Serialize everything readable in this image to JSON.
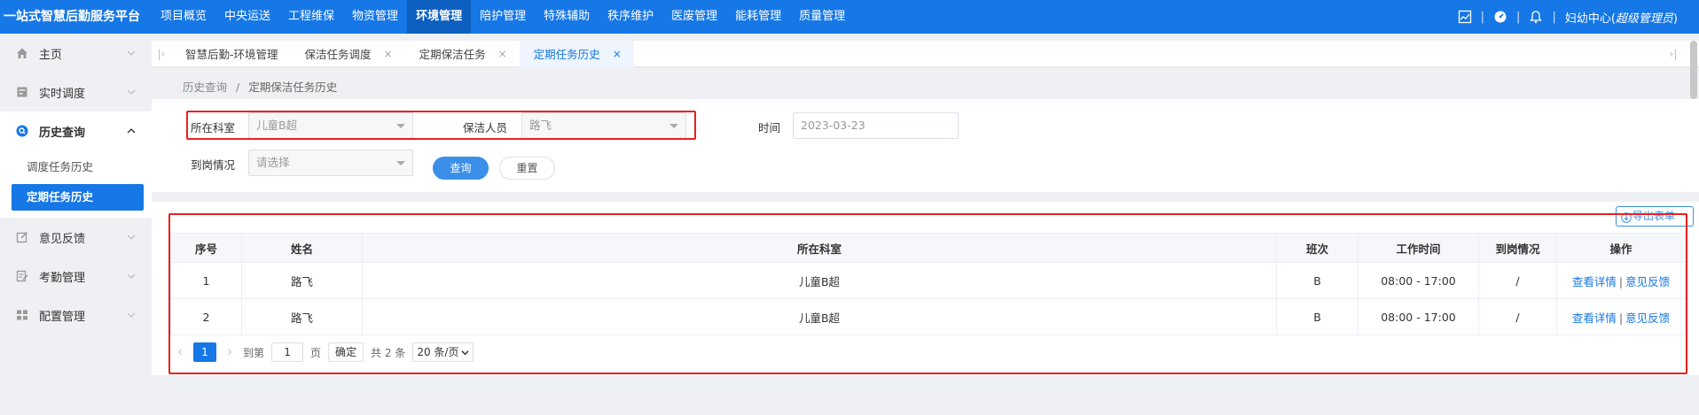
{
  "app": {
    "brand": "一站式智慧后勤服务平台"
  },
  "nav": {
    "items": [
      "项目概览",
      "中央运送",
      "工程维保",
      "物资管理",
      "环境管理",
      "陪护管理",
      "特殊辅助",
      "秩序维护",
      "医废管理",
      "能耗管理",
      "质量管理"
    ],
    "active_index": 4
  },
  "header_right": {
    "separator": "|",
    "user_prefix": "妇幼中心(",
    "user_role": "超级管理员",
    "user_suffix": ")"
  },
  "sidebar": {
    "home": "主页",
    "dispatch": "实时调度",
    "history": "历史查询",
    "history_sub": [
      "调度任务历史",
      "定期任务历史"
    ],
    "feedback": "意见反馈",
    "attendance": "考勤管理",
    "config": "配置管理"
  },
  "tabs": {
    "items": [
      "智慧后勤-环境管理",
      "保洁任务调度",
      "定期保洁任务",
      "定期任务历史"
    ],
    "active_index": 3,
    "close": "×"
  },
  "breadcrumb": {
    "parent": "历史查询",
    "sep": "/",
    "current": "定期保洁任务历史"
  },
  "filters": {
    "dept_label": "所在科室",
    "dept_value": "儿童B超",
    "staff_label": "保洁人员",
    "staff_value": "路飞",
    "time_label": "时间",
    "time_value": "2023-03-23",
    "arrival_label": "到岗情况",
    "arrival_placeholder": "请选择",
    "search_btn": "查询",
    "reset_btn": "重置"
  },
  "export": {
    "label": "导出表单"
  },
  "table": {
    "headers": [
      "序号",
      "姓名",
      "所在科室",
      "班次",
      "工作时间",
      "到岗情况",
      "操作"
    ],
    "rows": [
      {
        "no": "1",
        "name": "路飞",
        "dept": "儿童B超",
        "shift": "B",
        "time": "08:00 - 17:00",
        "arrival": "/"
      },
      {
        "no": "2",
        "name": "路飞",
        "dept": "儿童B超",
        "shift": "B",
        "time": "08:00 - 17:00",
        "arrival": "/"
      }
    ],
    "op_detail": "查看详情",
    "op_sep": "|",
    "op_feedback": "意见反馈"
  },
  "pager": {
    "current": "1",
    "goto_label": "到第",
    "goto_value": "1",
    "page_unit": "页",
    "confirm": "确定",
    "total": "共 2 条",
    "page_size": "20 条/页"
  },
  "colors": {
    "primary": "#1677e6",
    "highlight_border": "#e82020"
  }
}
